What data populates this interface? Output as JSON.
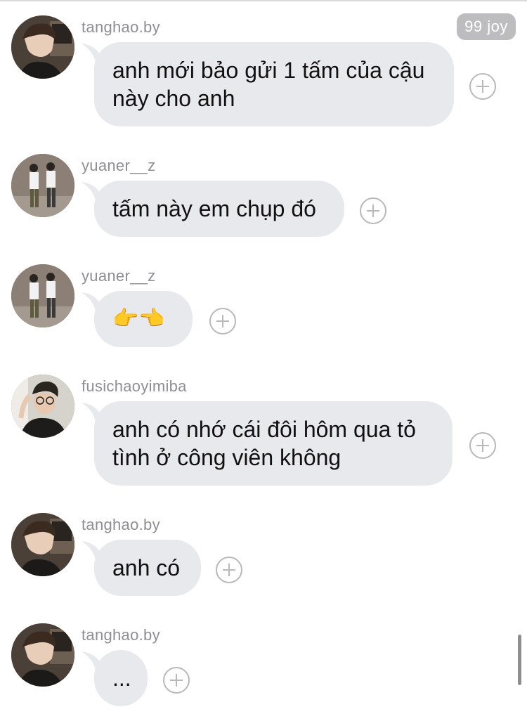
{
  "badge": {
    "text": "99 joy"
  },
  "messages": [
    {
      "username": "tanghao.by",
      "avatar": "avatar-tanghao",
      "text": "anh mới bảo gửi 1 tấm của cậu này cho anh"
    },
    {
      "username": "yuaner__z",
      "avatar": "avatar-yuaner",
      "text": "tấm này em chụp đó"
    },
    {
      "username": "yuaner__z",
      "avatar": "avatar-yuaner",
      "text": "👉👈"
    },
    {
      "username": "fusichaoyimiba",
      "avatar": "avatar-fusichao",
      "text": "anh có nhớ cái đôi hôm qua tỏ tình ở công viên không"
    },
    {
      "username": "tanghao.by",
      "avatar": "avatar-tanghao",
      "text": "anh có"
    },
    {
      "username": "tanghao.by",
      "avatar": "avatar-tanghao",
      "text": "..."
    }
  ],
  "icons": {
    "react": "plus-circle-icon",
    "tail": "bubble-tail-icon"
  },
  "colors": {
    "bubble": "#e8e9ed",
    "username": "#8e8e93",
    "badge": "#bdbdc0",
    "react": "#b8b8bd"
  }
}
